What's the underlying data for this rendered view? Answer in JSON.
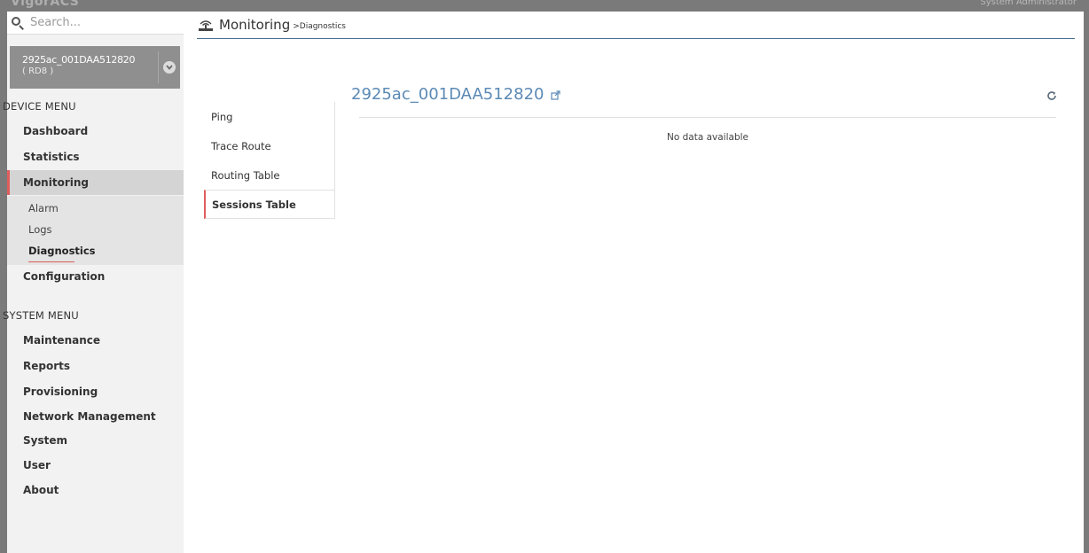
{
  "app": {
    "brand": "VigorACS",
    "user": "System Administrator"
  },
  "search": {
    "placeholder": "Search..."
  },
  "device": {
    "name": "2925ac_001DAA512820",
    "sub": "( RD8 )"
  },
  "sidebar": {
    "device_menu_title": "DEVICE MENU",
    "device_items": [
      {
        "label": "Dashboard"
      },
      {
        "label": "Statistics"
      },
      {
        "label": "Monitoring"
      },
      {
        "label": "Configuration"
      }
    ],
    "monitoring_subitems": [
      {
        "label": "Alarm"
      },
      {
        "label": "Logs"
      },
      {
        "label": "Diagnostics"
      }
    ],
    "system_menu_title": "SYSTEM MENU",
    "system_items": [
      {
        "label": "Maintenance"
      },
      {
        "label": "Reports"
      },
      {
        "label": "Provisioning"
      },
      {
        "label": "Network Management"
      },
      {
        "label": "System"
      },
      {
        "label": "User"
      },
      {
        "label": "About"
      }
    ]
  },
  "header": {
    "title": "Monitoring",
    "subtitle": ">Diagnostics"
  },
  "tabs": [
    {
      "label": "Ping"
    },
    {
      "label": "Trace Route"
    },
    {
      "label": "Routing Table"
    },
    {
      "label": "Sessions Table"
    }
  ],
  "content": {
    "title": "2925ac_001DAA512820",
    "empty_message": "No data available"
  },
  "colors": {
    "accent": "#e05c5c",
    "title_blue": "#5b8ab5",
    "sidebar_bg": "#f2f2f2"
  }
}
